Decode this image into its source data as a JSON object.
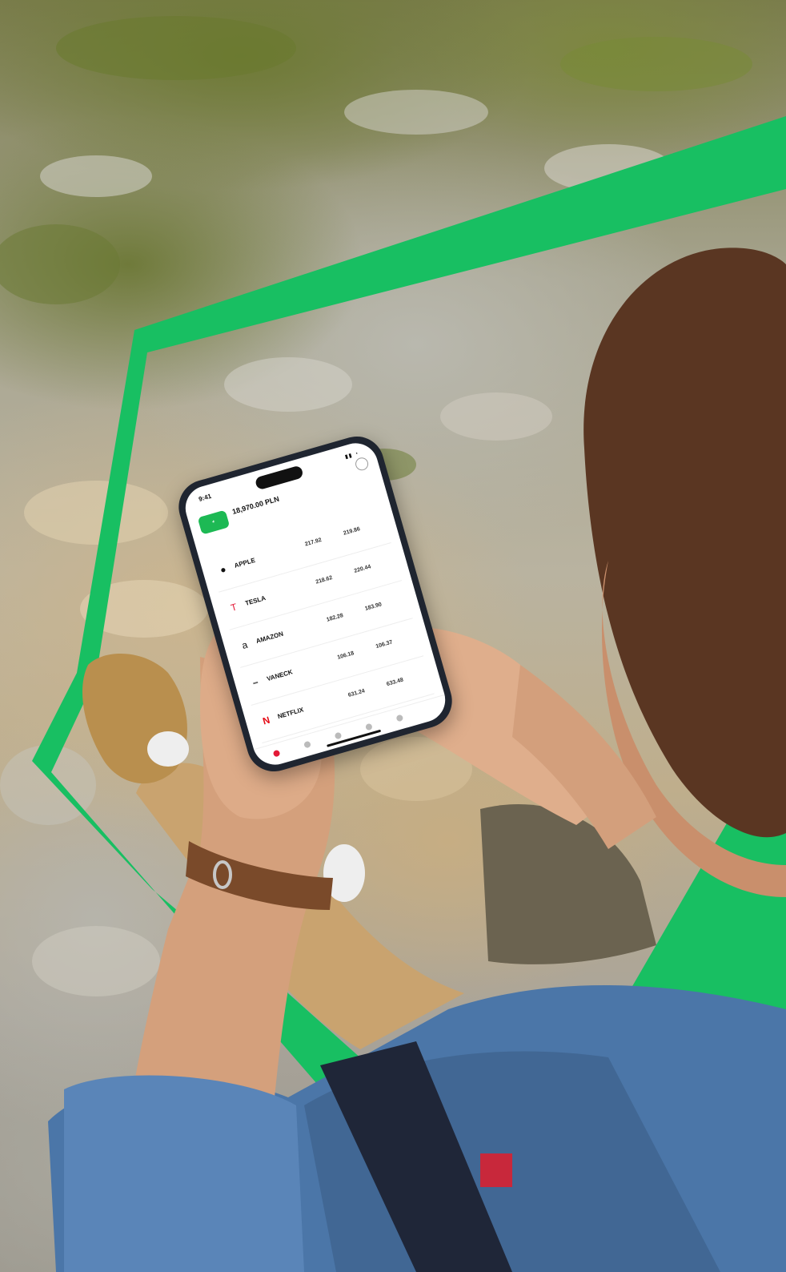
{
  "colors": {
    "brand_green": "#1db954",
    "frame_green": "#18bf62",
    "rock": "#b7b3a6",
    "grass": "#6f7a3a",
    "skin": "#d9a584",
    "shirt": "#4b76a8",
    "pants": "#6b6350",
    "khaki": "#c9a36f",
    "watch": "#7a4a2a",
    "hair": "#5a3622"
  },
  "icons": {
    "apple": "apple-icon",
    "tesla": "tesla-icon",
    "amazon": "amazon-icon",
    "vaneck": "vaneck-icon",
    "netflix": "netflix-icon",
    "search": "search-icon"
  },
  "phone": {
    "time": "9:41",
    "balance": "18,970.00 PLN",
    "stocks": [
      {
        "name": "APPLE",
        "v1": "217.92",
        "v2": "219.86"
      },
      {
        "name": "TESLA",
        "v1": "218.62",
        "v2": "220.44"
      },
      {
        "name": "AMAZON",
        "v1": "182.28",
        "v2": "183.90"
      },
      {
        "name": "VANECK",
        "v1": "106.18",
        "v2": "106.37"
      },
      {
        "name": "NETFLIX",
        "v1": "631.24",
        "v2": "633.48"
      }
    ]
  }
}
